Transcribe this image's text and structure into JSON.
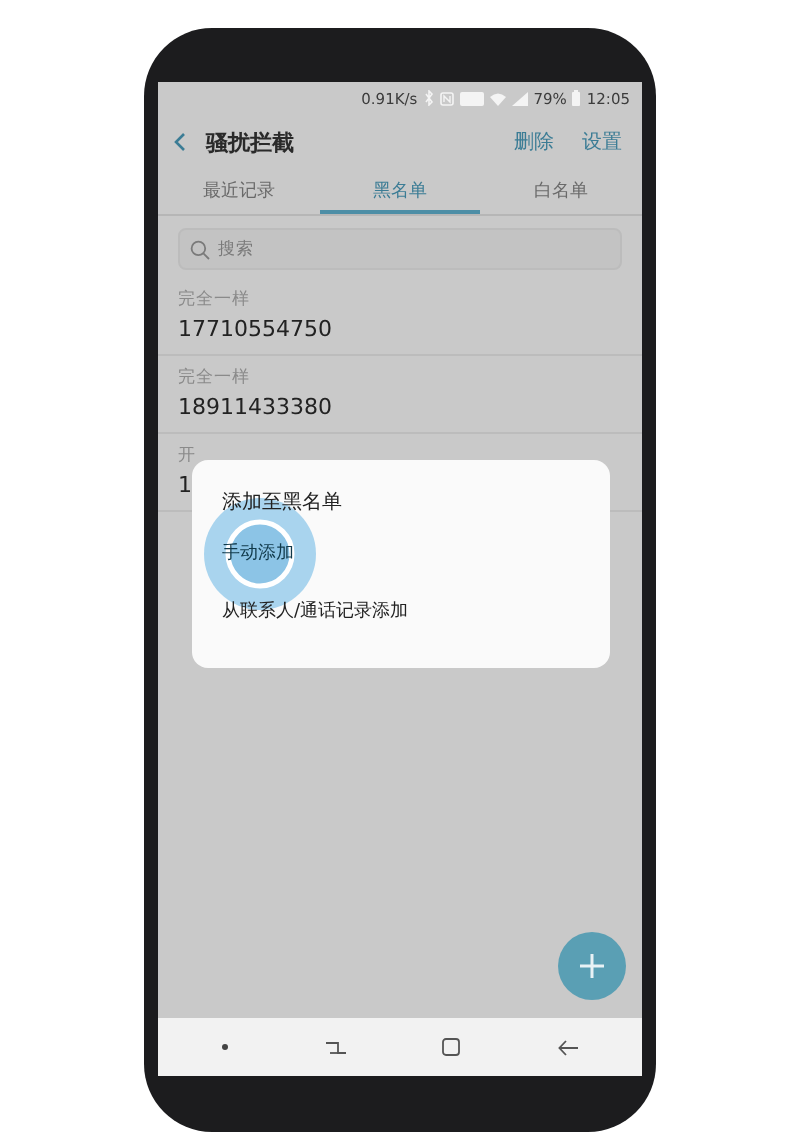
{
  "status_bar": {
    "speed": "0.91K/s",
    "battery": "79%",
    "time": "12:05"
  },
  "header": {
    "title": "骚扰拦截",
    "actions": [
      "删除",
      "设置"
    ]
  },
  "tabs": [
    {
      "label": "最近记录",
      "selected": false
    },
    {
      "label": "黑名单",
      "selected": true
    },
    {
      "label": "白名单",
      "selected": false
    }
  ],
  "search": {
    "placeholder": "搜索"
  },
  "entries": [
    {
      "rule": "完全一样",
      "number": "17710554750"
    },
    {
      "rule": "完全一样",
      "number": "18911433380"
    },
    {
      "rule": "开",
      "number": "1"
    }
  ],
  "dialog": {
    "title": "添加至黑名单",
    "options": [
      {
        "label": "手动添加",
        "pressed": true
      },
      {
        "label": "从联系人/通话记录添加",
        "pressed": false
      }
    ]
  }
}
